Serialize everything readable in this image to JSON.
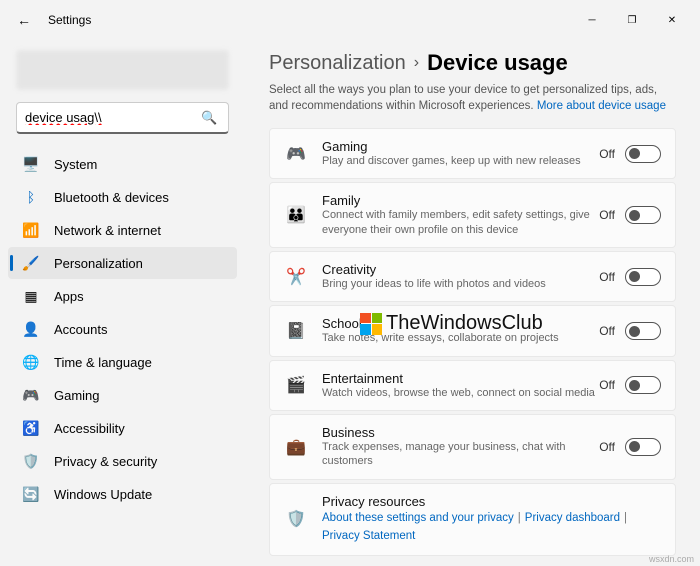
{
  "window": {
    "title": "Settings"
  },
  "search": {
    "value": "device usag\\\\"
  },
  "nav": {
    "items": [
      {
        "label": "System"
      },
      {
        "label": "Bluetooth & devices"
      },
      {
        "label": "Network & internet"
      },
      {
        "label": "Personalization"
      },
      {
        "label": "Apps"
      },
      {
        "label": "Accounts"
      },
      {
        "label": "Time & language"
      },
      {
        "label": "Gaming"
      },
      {
        "label": "Accessibility"
      },
      {
        "label": "Privacy & security"
      },
      {
        "label": "Windows Update"
      }
    ]
  },
  "breadcrumb": {
    "parent": "Personalization",
    "current": "Device usage"
  },
  "subtitle": {
    "text": "Select all the ways you plan to use your device to get personalized tips, ads, and recommendations within Microsoft experiences. ",
    "link": "More about device usage"
  },
  "cards": [
    {
      "title": "Gaming",
      "desc": "Play and discover games, keep up with new releases",
      "state": "Off"
    },
    {
      "title": "Family",
      "desc": "Connect with family members, edit safety settings, give everyone their own profile on this device",
      "state": "Off"
    },
    {
      "title": "Creativity",
      "desc": "Bring your ideas to life with photos and videos",
      "state": "Off"
    },
    {
      "title": "School",
      "desc": "Take notes, write essays, collaborate on projects",
      "state": "Off"
    },
    {
      "title": "Entertainment",
      "desc": "Watch videos, browse the web, connect on social media",
      "state": "Off"
    },
    {
      "title": "Business",
      "desc": "Track expenses, manage your business, chat with customers",
      "state": "Off"
    }
  ],
  "privacy": {
    "title": "Privacy resources",
    "link1": "About these settings and your privacy",
    "link2": "Privacy dashboard",
    "link3": "Privacy Statement"
  },
  "watermark": "TheWindowsClub",
  "footer": "wsxdn.com"
}
